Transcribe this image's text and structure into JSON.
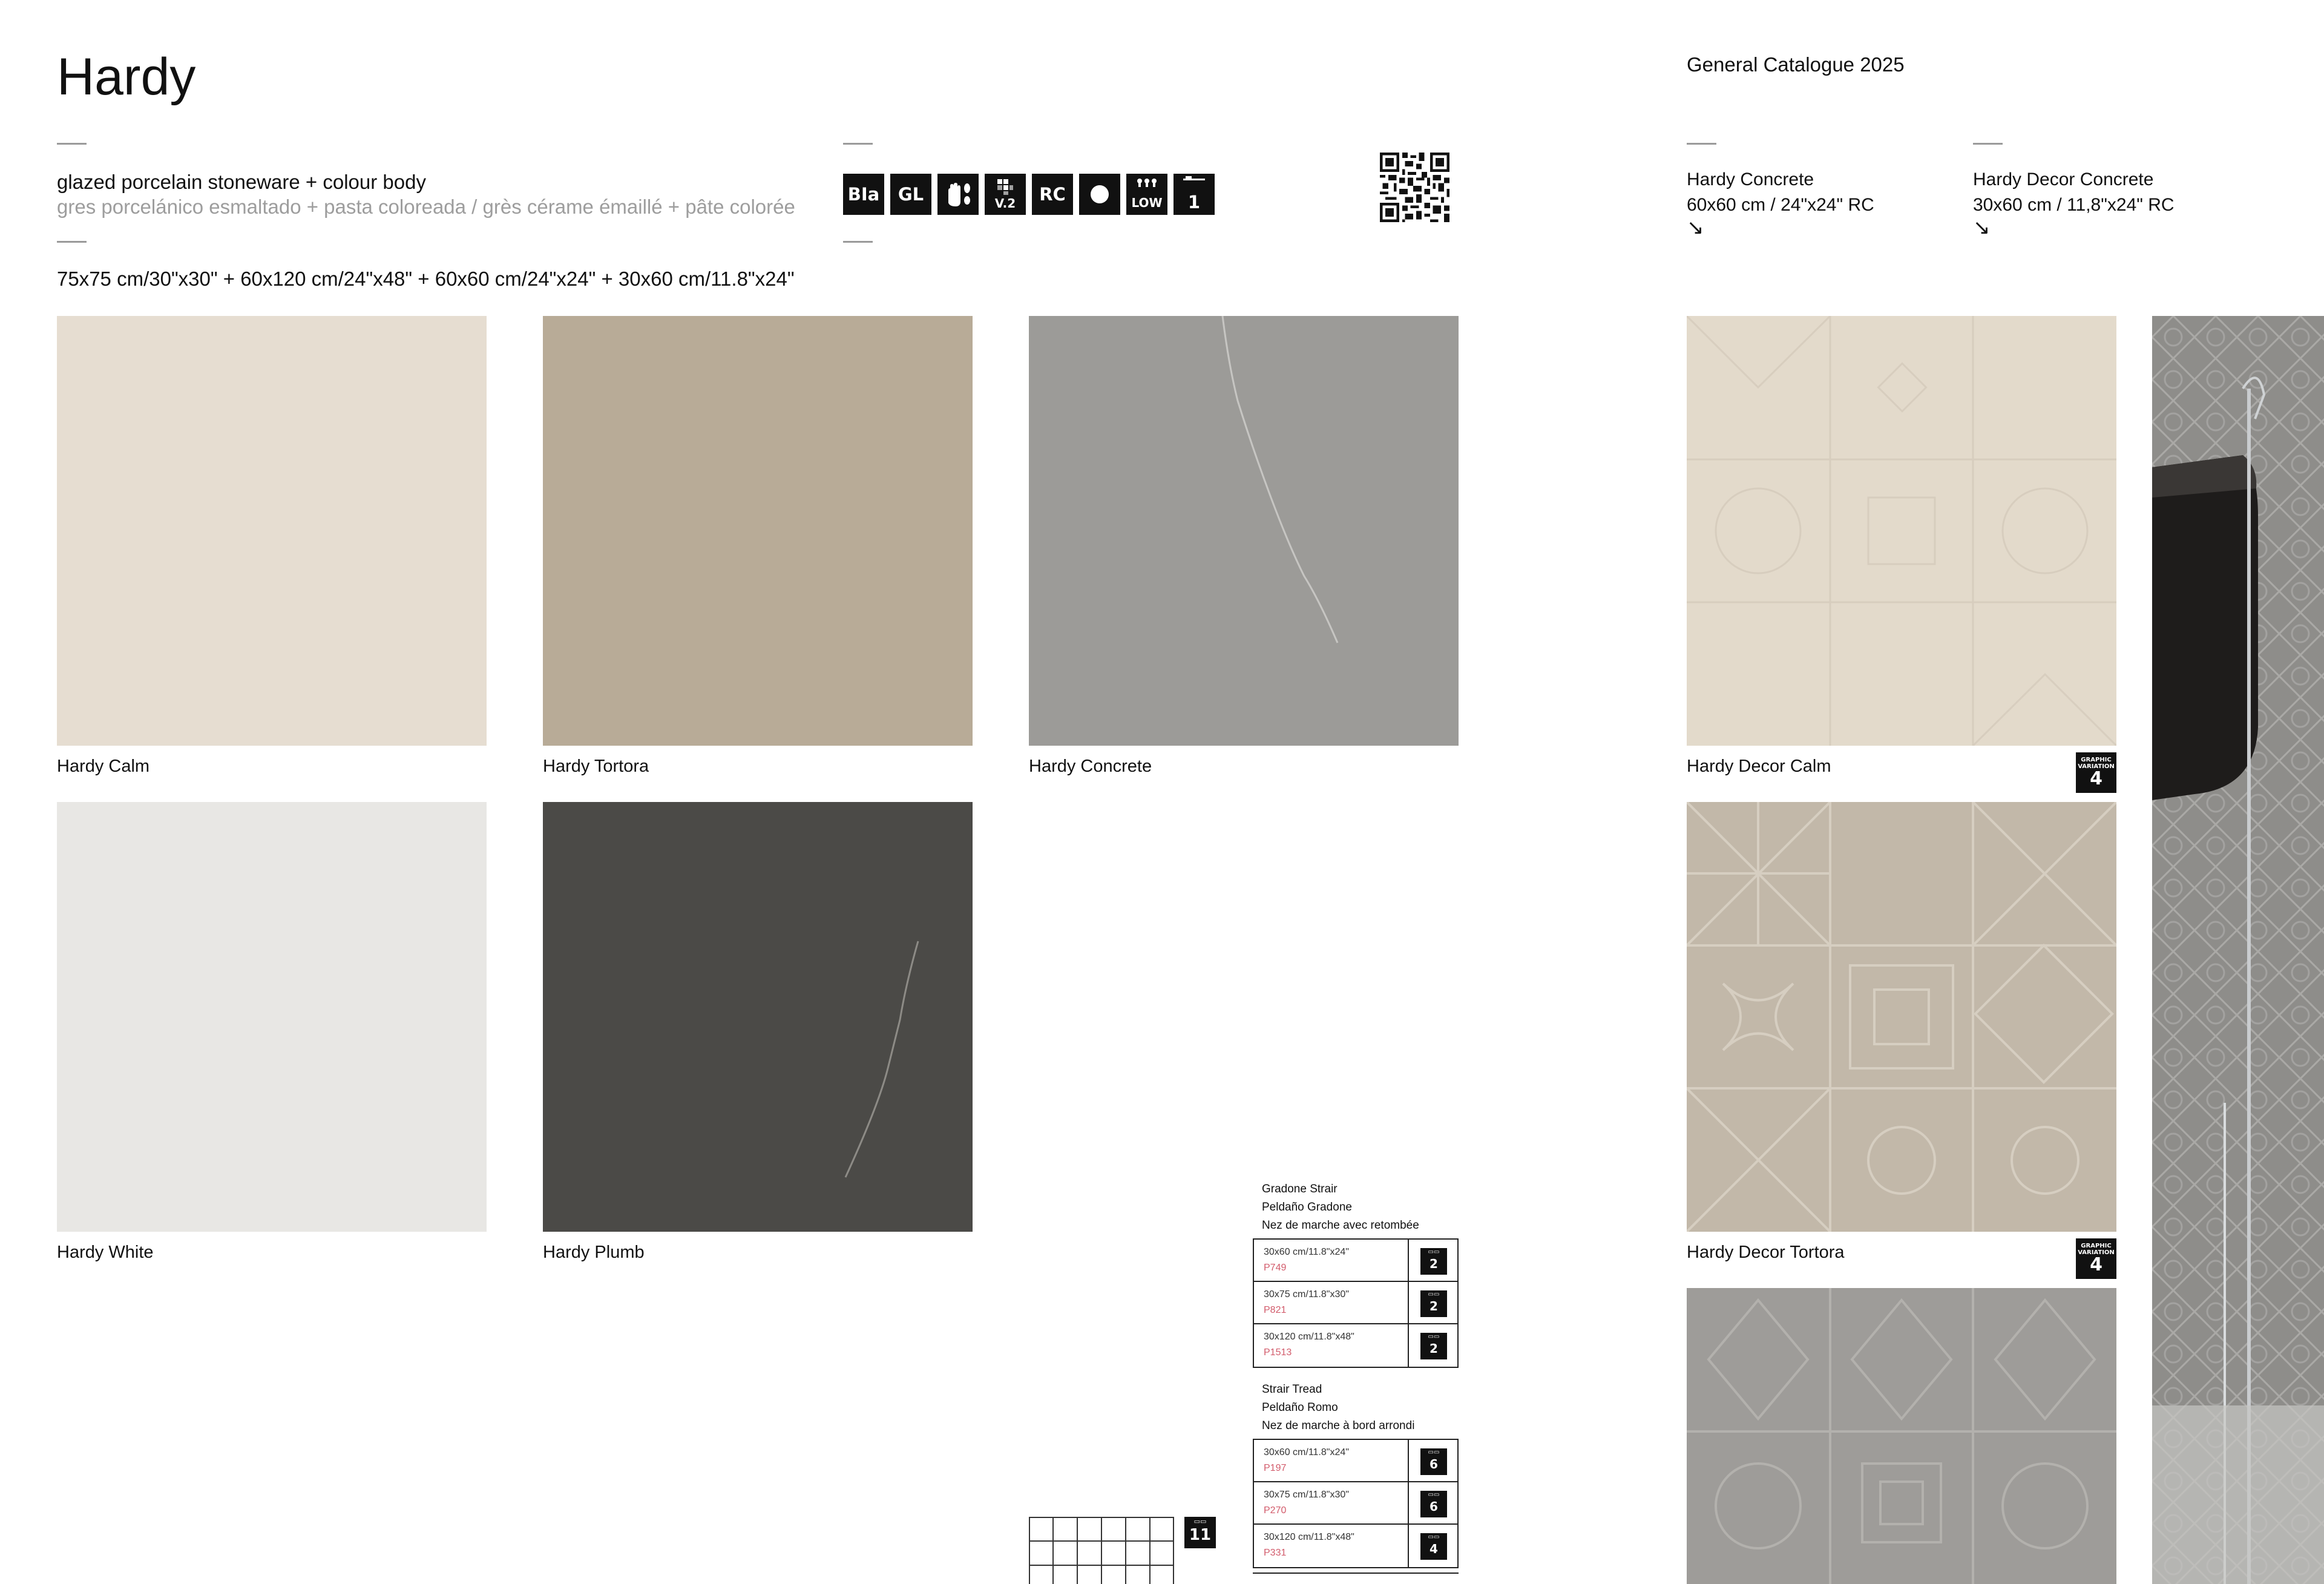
{
  "header": {
    "title": "Hardy",
    "catalogue": "General Catalogue 2025"
  },
  "description": {
    "english": "glazed porcelain stoneware + colour body",
    "other_languages": "gres porcelánico esmaltado + pasta coloreada / grès cérame émaillé + pâte colorée",
    "sizes": "75x75 cm/30\"x30\" + 60x120 cm/24\"x48\" + 60x60 cm/24\"x24\" + 30x60 cm/11.8\"x24\""
  },
  "features": {
    "bla": "BIa",
    "gl": "GL",
    "slip_label": "V.2",
    "rc": "RC",
    "low": "LOW",
    "one": "1"
  },
  "related": [
    {
      "name": "Hardy Concrete",
      "size": "60x60 cm / 24\"x24\" RC",
      "arrow": "↘"
    },
    {
      "name": "Hardy Decor Concrete",
      "size": "30x60 cm / 11,8\"x24\" RC",
      "arrow": "↘"
    }
  ],
  "tiles": [
    {
      "name": "Hardy Calm",
      "color": "#e6ddd1"
    },
    {
      "name": "Hardy Tortora",
      "color": "#b8ab97"
    },
    {
      "name": "Hardy Concrete",
      "color": "#9c9b98"
    },
    {
      "name": "Hardy White",
      "color": "#e8e7e4"
    },
    {
      "name": "Hardy Plumb",
      "color": "#4b4a47"
    }
  ],
  "decor_tiles": [
    {
      "name": "Hardy Decor Calm",
      "color": "#e3dacb",
      "badge_text": "GRAPHIC VARIATION",
      "badge_num": "4"
    },
    {
      "name": "Hardy Decor Tortora",
      "color": "#c2b8a9",
      "badge_text": "GRAPHIC VARIATION",
      "badge_num": "4"
    },
    {
      "name": "",
      "color": "#9e9c99"
    }
  ],
  "trims": {
    "gradone": {
      "heading": [
        "Gradone Strair",
        "Peldaño Gradone",
        "Nez de marche avec retombée"
      ],
      "rows": [
        {
          "size": "30x60 cm/11.8\"x24\"",
          "code": "P749",
          "pieces": "2"
        },
        {
          "size": "30x75 cm/11.8\"x30\"",
          "code": "P821",
          "pieces": "2"
        },
        {
          "size": "30x120 cm/11.8\"x48\"",
          "code": "P1513",
          "pieces": "2"
        }
      ]
    },
    "tread": {
      "heading": [
        "Strair Tread",
        "Peldaño Romo",
        "Nez de marche à bord arrondi"
      ],
      "rows": [
        {
          "size": "30x60 cm/11.8\"x24\"",
          "code": "P197",
          "pieces": "6"
        },
        {
          "size": "30x75 cm/11.8\"x30\"",
          "code": "P270",
          "pieces": "6"
        },
        {
          "size": "30x120 cm/11.8\"x48\"",
          "code": "P331",
          "pieces": "4"
        }
      ]
    }
  },
  "mosaic": {
    "pieces": "11"
  }
}
